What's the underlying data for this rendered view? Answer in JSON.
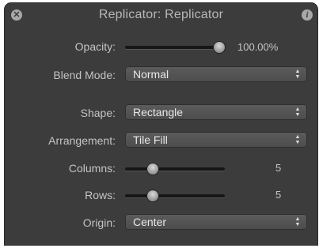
{
  "window": {
    "title": "Replicator: Replicator",
    "close_icon": "close-icon",
    "info_icon": "info-icon",
    "close_glyph": "✕",
    "info_glyph": "i"
  },
  "opacity": {
    "label": "Opacity:",
    "value_text": "100.00%",
    "level": 1.0
  },
  "blend_mode": {
    "label": "Blend Mode:",
    "value": "Normal"
  },
  "shape": {
    "label": "Shape:",
    "value": "Rectangle"
  },
  "arrangement": {
    "label": "Arrangement:",
    "value": "Tile Fill"
  },
  "columns": {
    "label": "Columns:",
    "value_text": "5",
    "level": 0.25
  },
  "rows": {
    "label": "Rows:",
    "value_text": "5",
    "level": 0.25
  },
  "origin": {
    "label": "Origin:",
    "value": "Center"
  },
  "popup_arrows": {
    "up": "▲",
    "down": "▼"
  },
  "colors": {
    "panel": "#3c3c3c",
    "label": "#c4c4c4",
    "popup": "#505050"
  }
}
